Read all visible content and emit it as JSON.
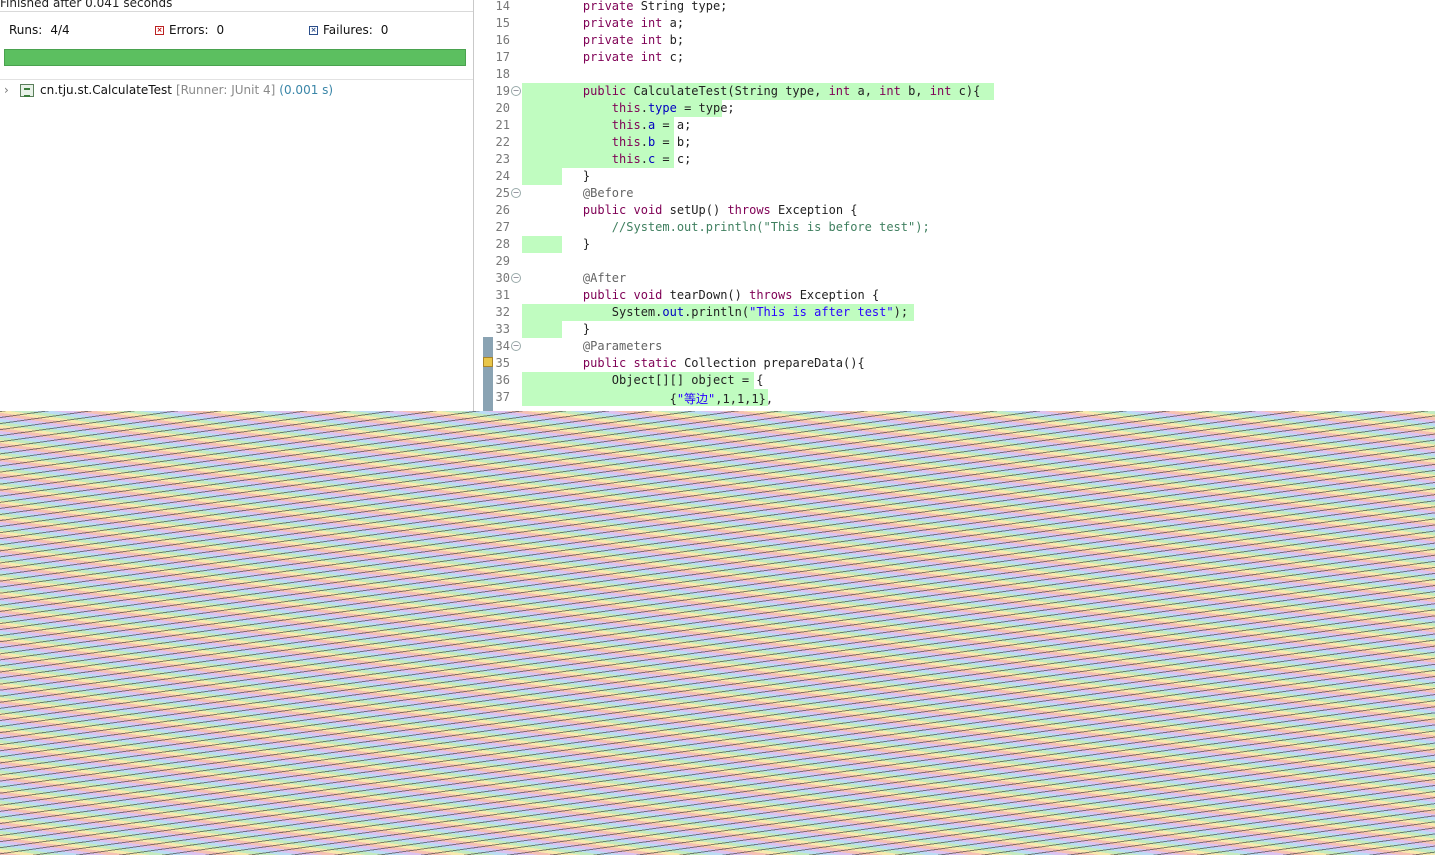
{
  "junit": {
    "finished_text": "Finished after 0.041 seconds",
    "runs_label": "Runs:",
    "runs_value": "4/4",
    "errors_label": "Errors:",
    "errors_value": "0",
    "failures_label": "Failures:",
    "failures_value": "0",
    "progress_percent": 100,
    "progress_color": "#5cbf60",
    "tree": {
      "name": "cn.tju.st.CalculateTest",
      "runner": "[Runner: JUnit 4]",
      "time": "(0.001 s)"
    }
  },
  "editor": {
    "highlight_color": "#c0fcc0",
    "lines": [
      {
        "n": "14",
        "code": "    private String type;"
      },
      {
        "n": "15",
        "code": "    private int a;"
      },
      {
        "n": "16",
        "code": "    private int b;"
      },
      {
        "n": "17",
        "code": "    private int c;"
      },
      {
        "n": "18",
        "code": ""
      },
      {
        "n": "19",
        "code": "    public CalculateTest(String type, int a, int b, int c){"
      },
      {
        "n": "20",
        "code": "        this.type = type;"
      },
      {
        "n": "21",
        "code": "        this.a = a;"
      },
      {
        "n": "22",
        "code": "        this.b = b;"
      },
      {
        "n": "23",
        "code": "        this.c = c;"
      },
      {
        "n": "24",
        "code": "    }"
      },
      {
        "n": "25",
        "code": "    @Before"
      },
      {
        "n": "26",
        "code": "    public void setUp() throws Exception {"
      },
      {
        "n": "27",
        "code": "        //System.out.println(\"This is before test\");"
      },
      {
        "n": "28",
        "code": "    }"
      },
      {
        "n": "29",
        "code": ""
      },
      {
        "n": "30",
        "code": "    @After"
      },
      {
        "n": "31",
        "code": "    public void tearDown() throws Exception {"
      },
      {
        "n": "32",
        "code": "        System.out.println(\"This is after test\");"
      },
      {
        "n": "33",
        "code": "    }"
      },
      {
        "n": "34",
        "code": "    @Parameters"
      },
      {
        "n": "35",
        "code": "    public static Collection prepareData(){"
      },
      {
        "n": "36",
        "code": "        Object[][] object = {"
      },
      {
        "n": "37",
        "code": "                {\"等边\",1,1,1},"
      }
    ]
  }
}
